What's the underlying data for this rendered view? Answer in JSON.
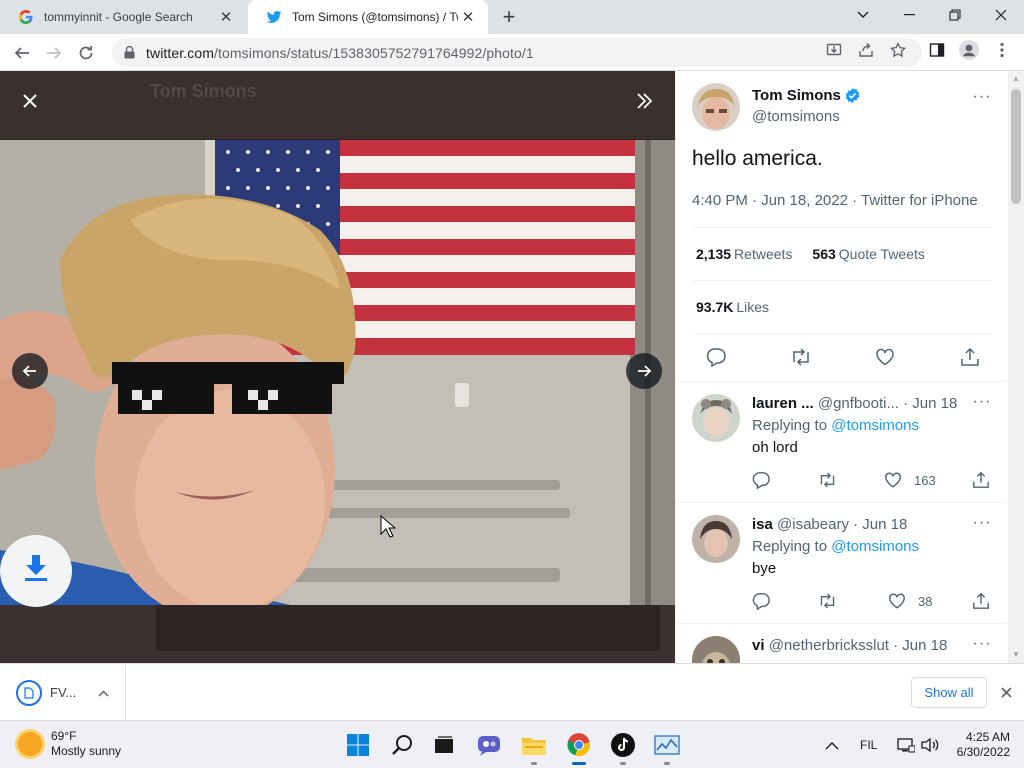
{
  "browser": {
    "tabs": [
      {
        "title": "tommyinnit - Google Search",
        "icon": "google-icon",
        "active": false
      },
      {
        "title": "Tom Simons (@tomsimons) / Tw",
        "icon": "twitter-icon",
        "active": true
      }
    ],
    "new_tab_glyph": "+",
    "url_host": "twitter.com",
    "url_path": "/tomsimons/status/1538305752791764992/photo/1"
  },
  "viewer": {
    "ghost_header": "Tom Simons"
  },
  "tweet": {
    "author_name": "Tom Simons",
    "author_handle": "@tomsimons",
    "text": "hello america.",
    "meta": "4:40 PM · Jun 18, 2022 · Twitter for iPhone",
    "retweets_count": "2,135",
    "retweets_label": "Retweets",
    "quotes_count": "563",
    "quotes_label": "Quote Tweets",
    "likes_count": "93.7K",
    "likes_label": "Likes",
    "more_glyph": "···"
  },
  "replies": [
    {
      "name": "lauren ...",
      "handle": "@gnfbooti...",
      "date": "· Jun 18",
      "replying_prefix": "Replying to",
      "mention": "@tomsimons",
      "text": "oh lord",
      "likes": "163"
    },
    {
      "name": "isa",
      "handle": "@isabeary",
      "date": "· Jun 18",
      "replying_prefix": "Replying to",
      "mention": "@tomsimons",
      "text": "bye",
      "likes": "38"
    },
    {
      "name": "vi",
      "handle": "@netherbricksslut",
      "date": "· Jun 18",
      "replying_prefix": "",
      "mention": "",
      "text": "",
      "likes": ""
    }
  ],
  "download_bar": {
    "item_name": "FV...",
    "show_all": "Show all"
  },
  "taskbar": {
    "temperature": "69°F",
    "condition": "Mostly sunny",
    "language": "FIL",
    "time": "4:25 AM",
    "date": "6/30/2022"
  },
  "colors": {
    "twitter_blue": "#1d9bf0",
    "chrome_blue": "#1a73e8",
    "text_primary": "#0f1419",
    "text_secondary": "#536471"
  }
}
